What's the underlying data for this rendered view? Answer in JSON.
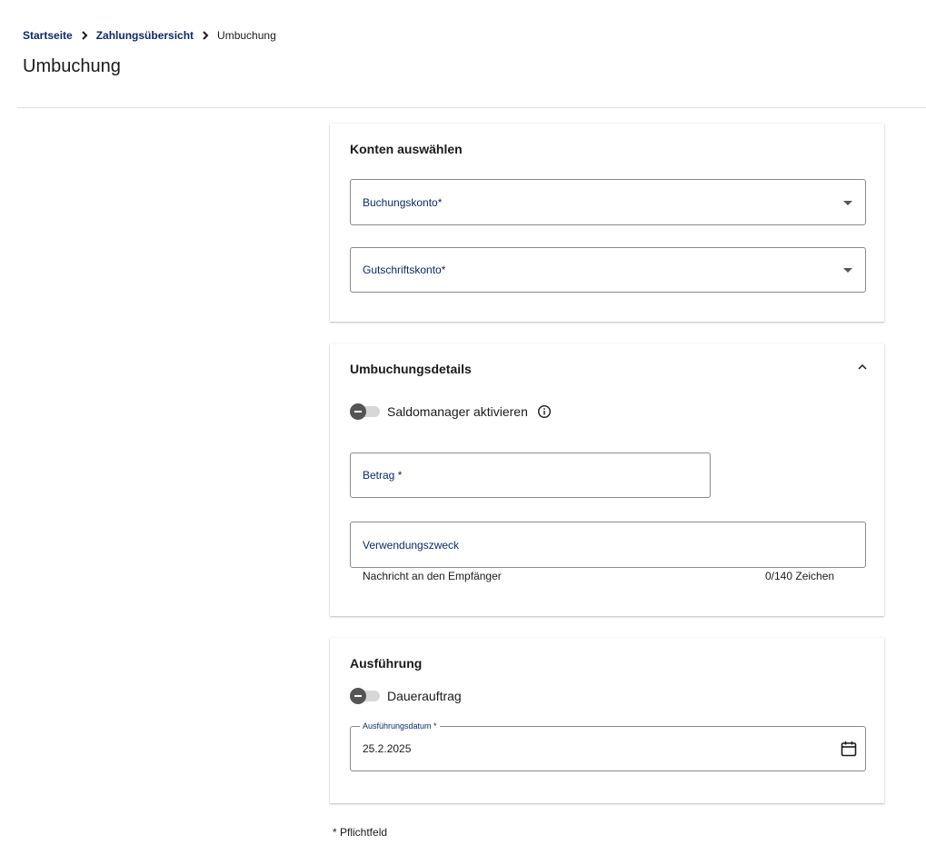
{
  "breadcrumb": {
    "items": [
      "Startseite",
      "Zahlungsübersicht"
    ],
    "current": "Umbuchung"
  },
  "page_title": "Umbuchung",
  "accounts_section": {
    "title": "Konten auswählen",
    "debit_account_label": "Buchungskonto*",
    "credit_account_label": "Gutschriftskonto*"
  },
  "details_section": {
    "title": "Umbuchungsdetails",
    "balance_manager_label": "Saldomanager aktivieren",
    "balance_manager_on": false,
    "amount_label": "Betrag *",
    "purpose_label": "Verwendungszweck",
    "purpose_hint": "Nachricht an den Empfänger",
    "purpose_counter": "0/140 Zeichen"
  },
  "execution_section": {
    "title": "Ausführung",
    "standing_order_label": "Dauerauftrag",
    "standing_order_on": false,
    "date_label": "Ausführungsdatum *",
    "date_value": "25.2.2025"
  },
  "footnote": "* Pflichtfeld",
  "colors": {
    "link": "#0a2a6b",
    "border": "#8a8a8a",
    "toggle_knob": "#555555"
  }
}
